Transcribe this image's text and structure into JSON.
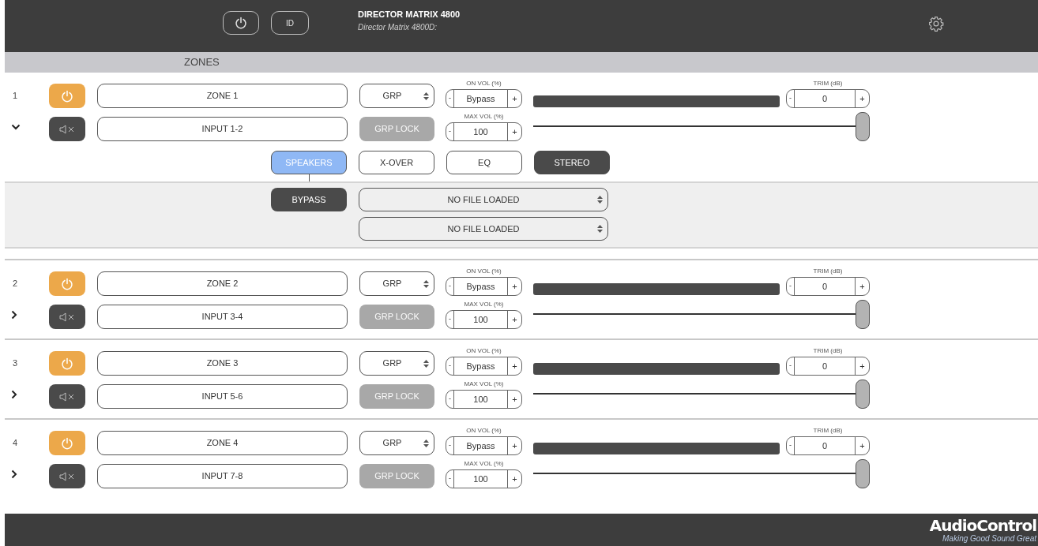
{
  "header": {
    "id_button": "ID",
    "title": "DIRECTOR MATRIX 4800",
    "subtitle": "Director Matrix 4800D:"
  },
  "section_title": "ZONES",
  "zones": [
    {
      "number": "1",
      "power_on": true,
      "name": "ZONE 1",
      "input": "INPUT 1-2",
      "muted": true,
      "expanded": true,
      "group": "GRP",
      "grp_lock": {
        "label": "GRP LOCK",
        "disabled": true
      },
      "on_vol_label": "ON VOL (%)",
      "on_vol": "Bypass",
      "max_vol_label": "MAX VOL (%)",
      "max_vol": "100",
      "trim_label": "TRIM (dB)",
      "trim": "0",
      "minus": "-",
      "plus": "+",
      "max_vol_slider": {
        "level": 1
      },
      "tabs": [
        {
          "label": "SPEAKERS",
          "selected": true,
          "on": false
        },
        {
          "label": "X-OVER",
          "selected": false,
          "on": false
        },
        {
          "label": "EQ",
          "selected": false,
          "on": false
        },
        {
          "label": "STEREO",
          "selected": false,
          "on": true
        }
      ],
      "panel": {
        "bypass": {
          "label": "BYPASS",
          "on": true
        },
        "files": [
          "NO FILE LOADED",
          "NO FILE LOADED"
        ]
      }
    },
    {
      "number": "2",
      "power_on": true,
      "name": "ZONE 2",
      "input": "INPUT 3-4",
      "muted": true,
      "expanded": false,
      "group": "GRP",
      "grp_lock": {
        "label": "GRP LOCK",
        "disabled": true
      },
      "on_vol_label": "ON VOL (%)",
      "on_vol": "Bypass",
      "max_vol_label": "MAX VOL (%)",
      "max_vol": "100",
      "trim_label": "TRIM (dB)",
      "trim": "0",
      "minus": "-",
      "plus": "+",
      "max_vol_slider": {
        "level": 1
      }
    },
    {
      "number": "3",
      "power_on": true,
      "name": "ZONE 3",
      "input": "INPUT 5-6",
      "muted": true,
      "expanded": false,
      "group": "GRP",
      "grp_lock": {
        "label": "GRP LOCK",
        "disabled": true
      },
      "on_vol_label": "ON VOL (%)",
      "on_vol": "Bypass",
      "max_vol_label": "MAX VOL (%)",
      "max_vol": "100",
      "trim_label": "TRIM (dB)",
      "trim": "0",
      "minus": "-",
      "plus": "+",
      "max_vol_slider": {
        "level": 1
      }
    },
    {
      "number": "4",
      "power_on": true,
      "name": "ZONE 4",
      "input": "INPUT 7-8",
      "muted": true,
      "expanded": false,
      "group": "GRP",
      "grp_lock": {
        "label": "GRP LOCK",
        "disabled": true
      },
      "on_vol_label": "ON VOL (%)",
      "on_vol": "Bypass",
      "max_vol_label": "MAX VOL (%)",
      "max_vol": "100",
      "trim_label": "TRIM (dB)",
      "trim": "0",
      "minus": "-",
      "plus": "+",
      "max_vol_slider": {
        "level": 1
      }
    }
  ],
  "footer": {
    "logo": "AudioControl",
    "tagline": "Making Good Sound Great"
  }
}
